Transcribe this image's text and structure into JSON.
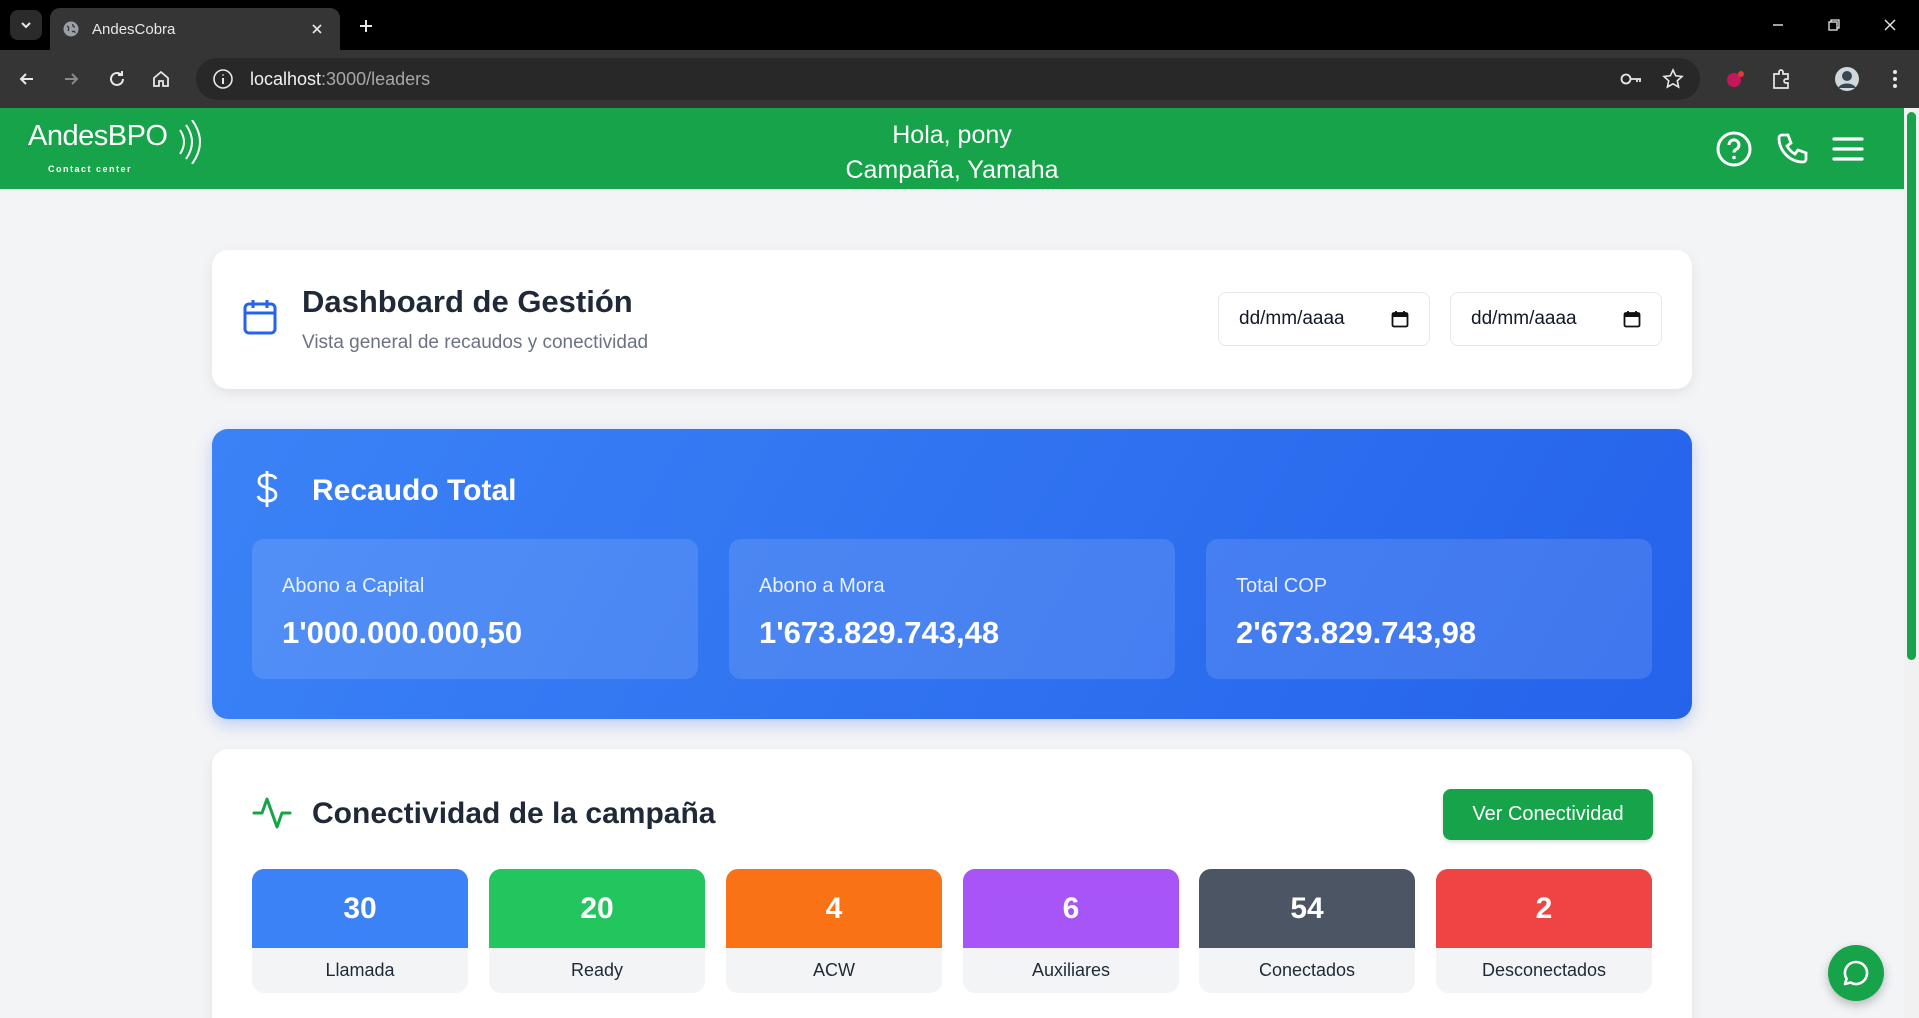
{
  "browser": {
    "tab_title": "AndesCobra",
    "url_host": "localhost",
    "url_rest": ":3000/leaders"
  },
  "header": {
    "logo_text": "AndesBPO",
    "logo_sub": "Contact center",
    "greeting": "Hola, pony",
    "campaign": "Campaña, Yamaha"
  },
  "dashboard": {
    "title": "Dashboard de Gestión",
    "subtitle": "Vista general de recaudos y conectividad",
    "date_from_placeholder": "dd/mm/aaaa",
    "date_to_placeholder": "dd/mm/aaaa"
  },
  "recaudo": {
    "title": "Recaudo Total",
    "items": [
      {
        "label": "Abono a Capital",
        "value": "1'000.000.000,50"
      },
      {
        "label": "Abono a Mora",
        "value": "1'673.829.743,48"
      },
      {
        "label": "Total COP",
        "value": "2'673.829.743,98"
      }
    ]
  },
  "conectividad": {
    "title": "Conectividad de la campaña",
    "button_label": "Ver Conectividad",
    "stats": [
      {
        "value": "30",
        "label": "Llamada",
        "color": "#3b82f6"
      },
      {
        "value": "20",
        "label": "Ready",
        "color": "#22c55e"
      },
      {
        "value": "4",
        "label": "ACW",
        "color": "#f97316"
      },
      {
        "value": "6",
        "label": "Auxiliares",
        "color": "#a855f7"
      },
      {
        "value": "54",
        "label": "Conectados",
        "color": "#4b5563"
      },
      {
        "value": "2",
        "label": "Desconectados",
        "color": "#ef4444"
      }
    ]
  },
  "colors": {
    "brand_green": "#16a34a",
    "blue_gradient_start": "#3b82f6",
    "blue_gradient_end": "#2563eb"
  },
  "icons": {
    "header": [
      "help-circle-icon",
      "phone-icon",
      "menu-icon"
    ],
    "dashboard": "calendar-icon",
    "recaudo": "dollar-icon",
    "conectividad": "activity-icon",
    "fab": "chat-icon"
  }
}
